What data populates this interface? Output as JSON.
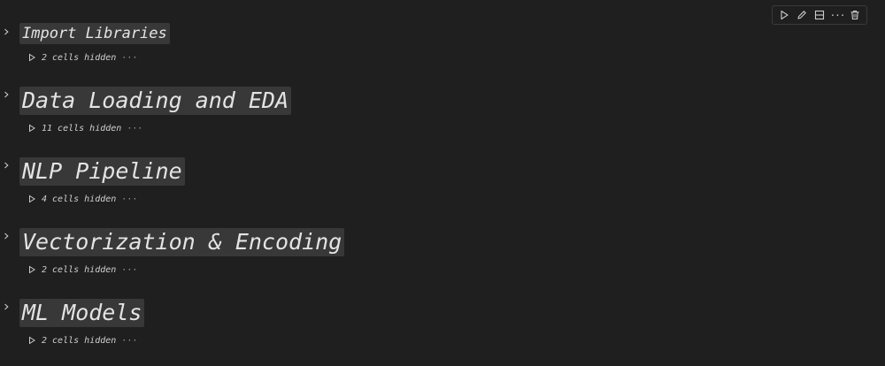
{
  "toolbar": {
    "buttons": [
      {
        "icon": "run-icon"
      },
      {
        "icon": "edit-icon"
      },
      {
        "icon": "split-cell-icon"
      },
      {
        "icon": "more-actions-icon"
      },
      {
        "icon": "delete-icon"
      }
    ],
    "more_label": "···"
  },
  "sections": [
    {
      "title": "Import Libraries",
      "hidden_label": "2 cells hidden",
      "ellipsis": "···"
    },
    {
      "title": "Data Loading and EDA",
      "hidden_label": "11 cells hidden",
      "ellipsis": "···"
    },
    {
      "title": "NLP Pipeline",
      "hidden_label": "4 cells hidden",
      "ellipsis": "···"
    },
    {
      "title": "Vectorization & Encoding",
      "hidden_label": "2 cells hidden",
      "ellipsis": "···"
    },
    {
      "title": "ML Models",
      "hidden_label": "2 cells hidden",
      "ellipsis": "···"
    }
  ],
  "colors": {
    "background": "#1f1f1f",
    "heading_bg": "#383838",
    "text": "#e4e4e4",
    "muted": "#9a9a9a"
  }
}
